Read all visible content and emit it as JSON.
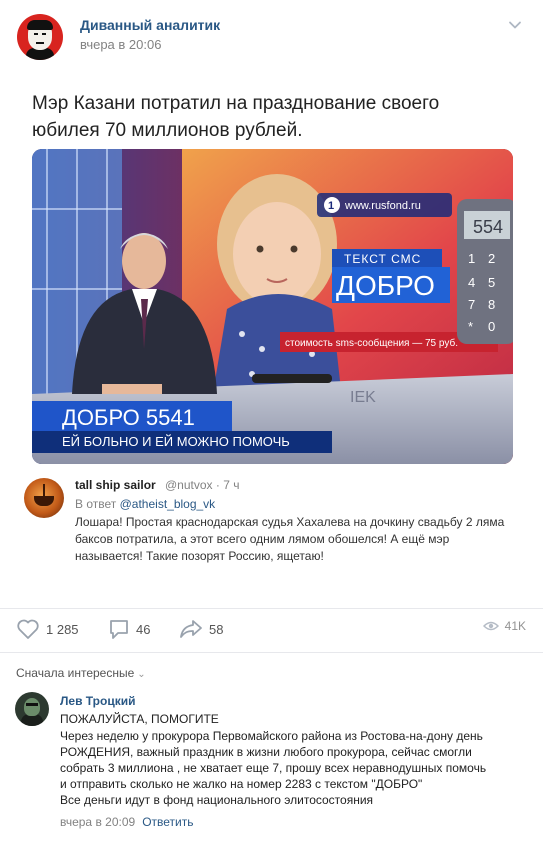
{
  "post": {
    "author": "Диванный аналитик",
    "time": "вчера в 20:06",
    "text": "Мэр Казани потратил на празднование своего юбилея 70 миллионов рублей.",
    "options_icon": "chevron-down-icon"
  },
  "video": {
    "channel_url": "www.rusfond.ru",
    "sms_label": "ТЕКСТ СМС",
    "sms_word": "ДОБРО",
    "sms_cost": "стоимость sms-сообщения — 75 руб.",
    "lower_third_title": "ДОБРО 5541",
    "lower_third_sub": "ЕЙ БОЛЬНО И ЕЙ МОЖНО ПОМОЧЬ",
    "phone_digits": [
      "554",
      "1",
      "2",
      "4",
      "5",
      "7",
      "8",
      "*",
      "0"
    ],
    "desk_text": "IEK"
  },
  "tweet": {
    "name": "tall ship sailor",
    "handle": "@nutvox · 7 ч",
    "reply_prefix": "В ответ",
    "reply_to": "@atheist_blog_vk",
    "text": "Лошара! Простая краснодарская судья Хахалева на дочкину свадьбу 2 ляма баксов потратила, а этот всего одним лямом обошелся! А ещё мэр называется! Такие позорят Россию, ящетаю!"
  },
  "actions": {
    "likes": "1 285",
    "comments": "46",
    "shares": "58",
    "views": "41K"
  },
  "comments_section": {
    "sort_label": "Сначала интересные"
  },
  "comment": {
    "name": "Лев Троцкий",
    "shout": "ПОЖАЛУЙСТА, ПОМОГИТЕ",
    "lines": [
      "Через неделю у прокурора Первомайского района из Ростова-на-дону день",
      "РОЖДЕНИЯ, важный праздник в жизни любого прокурора, сейчас смогли",
      "собрать 3 миллиона , не хватает еще 7, прошу всех неравнодушных помочь",
      "и отправить сколько не жалко на номер 2283 с текстом \"ДОБРО\"",
      "Все деньги идут в фонд национального элитосостояния"
    ],
    "time": "вчера в 20:09",
    "reply_label": "Ответить"
  },
  "colors": {
    "link": "#2a5885",
    "meta": "#828282",
    "divider": "#e7e8ec",
    "tv_blue": "#1d4fb8"
  }
}
